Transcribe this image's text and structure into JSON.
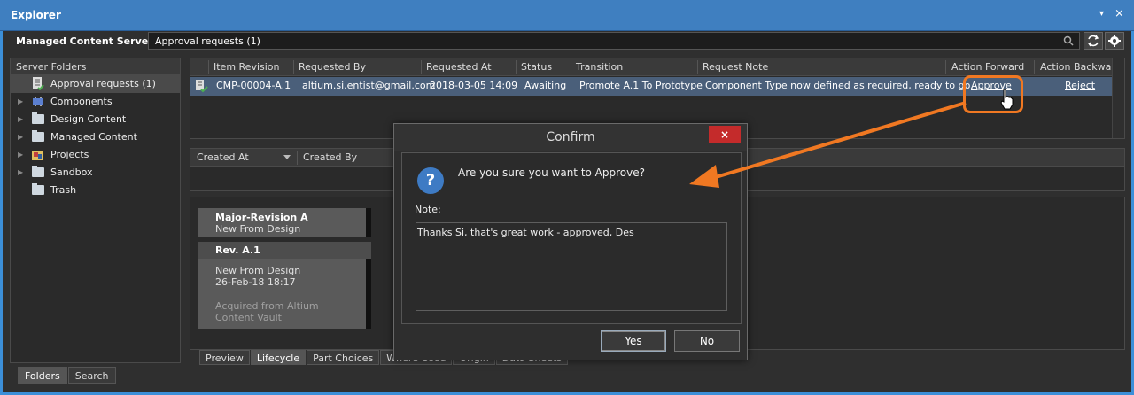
{
  "window": {
    "title": "Explorer",
    "pin_glyph": "▾",
    "close_glyph": "×"
  },
  "toolbar": {
    "server": "Managed Content Server",
    "server_caret": "▾",
    "path": "Approval requests (1)"
  },
  "sidebar": {
    "header": "Server Folders",
    "items": [
      {
        "label": "Approval requests (1)",
        "icon": "approval-list-icon",
        "selected": true
      },
      {
        "label": "Components",
        "icon": "components-icon"
      },
      {
        "label": "Design Content",
        "icon": "folder-icon"
      },
      {
        "label": "Managed Content",
        "icon": "folder-icon"
      },
      {
        "label": "Projects",
        "icon": "projects-icon"
      },
      {
        "label": "Sandbox",
        "icon": "folder-icon"
      },
      {
        "label": "Trash",
        "icon": "folder-icon"
      }
    ]
  },
  "bottom_tabs": [
    "Folders",
    "Search"
  ],
  "grid": {
    "columns": [
      "Item Revision",
      "Requested By",
      "Requested At",
      "Status",
      "Transition",
      "Request Note",
      "Action Forward",
      "Action Backward"
    ],
    "row": {
      "item_revision": "CMP-00004-A.1",
      "requested_by": "altium.si.entist@gmail.com",
      "requested_at": "2018-03-05 14:09",
      "status": "Awaiting",
      "transition": "Promote A.1 To Prototype",
      "request_note": "Component Type now defined as required, ready to go.",
      "action_forward": "Approve",
      "action_backward": "Reject"
    }
  },
  "grid2": {
    "columns": [
      "Created At",
      "Created By"
    ]
  },
  "lifecycle": {
    "card_a_title": "Major-Revision A",
    "card_a_sub": "New From Design",
    "card_b_title": "Rev. A.1",
    "card_b_line1": "New From Design",
    "card_b_line2": "26-Feb-18 18:17",
    "card_b_line3": "Acquired from Altium Content Vault"
  },
  "lower_tabs": [
    "Preview",
    "Lifecycle",
    "Part Choices",
    "Where-Used",
    "Origin",
    "Data Sheets"
  ],
  "dialog": {
    "title": "Confirm",
    "close_glyph": "×",
    "question_glyph": "?",
    "question": "Are you sure you want to Approve?",
    "note_label": "Note:",
    "note_value": "Thanks Si, that's great work - approved, Des",
    "yes": "Yes",
    "no": "No"
  },
  "colors": {
    "title_bar": "#3f7fc0",
    "selected_row": "#4a5f7a",
    "highlight": "#f07822",
    "close_red": "#c42b2b"
  }
}
